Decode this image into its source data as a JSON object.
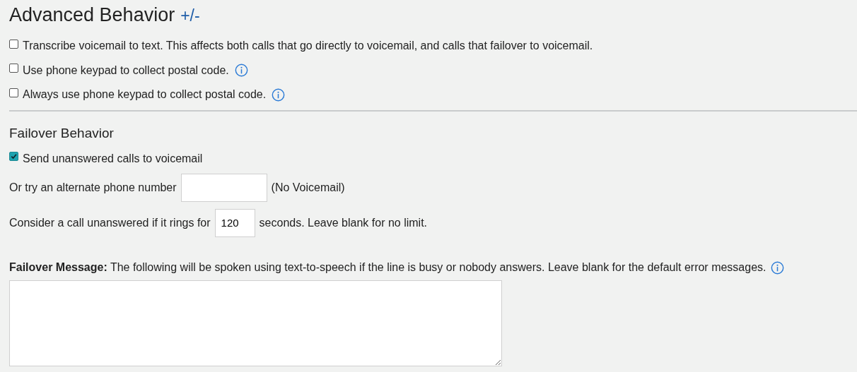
{
  "advanced": {
    "title": "Advanced Behavior",
    "toggle": "+/-",
    "options": [
      {
        "label": "Transcribe voicemail to text. This affects both calls that go directly to voicemail, and calls that failover to voicemail.",
        "checked": false,
        "info": false
      },
      {
        "label": "Use phone keypad to collect postal code.",
        "checked": false,
        "info": true
      },
      {
        "label": "Always use phone keypad to collect postal code.",
        "checked": false,
        "info": true
      }
    ]
  },
  "failover": {
    "title": "Failover Behavior",
    "send_to_voicemail": {
      "label": "Send unanswered calls to voicemail",
      "checked": true
    },
    "alternate": {
      "label": "Or try an alternate phone number",
      "note": "(No Voicemail)"
    },
    "ring": {
      "label": "Consider a call unanswered if it rings for",
      "value": "120",
      "note": "seconds. Leave blank for no limit."
    },
    "message": {
      "label": "**Failover Message:** The following will be spoken using text-to-speech if the line is busy or nobody answers. Leave blank for the default error messages.",
      "info": true
    }
  }
}
